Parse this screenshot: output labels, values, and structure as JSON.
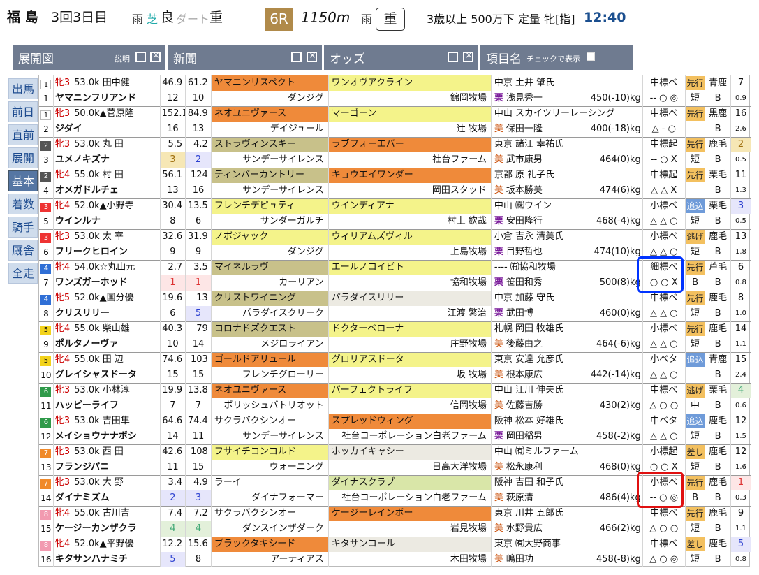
{
  "header": {
    "venue": "福 島",
    "meet": "3回3日目",
    "weather_label": "雨",
    "turf_label": "芝",
    "turf_state": "良",
    "dirt_label": "ダート",
    "dirt_state": "重",
    "race_no": "6R",
    "distance": "1150m",
    "weather2": "雨",
    "track_condition": "重",
    "class": "3歳以上 500万下 定量 牝[指]",
    "post_time": "12:40"
  },
  "toolbar": {
    "tenkai": "展開図",
    "setsumei": "説明",
    "shinbun": "新聞",
    "odds": "オッズ",
    "koumoku": "項目名",
    "check_label": "チェックで表示"
  },
  "sidenav": [
    "出馬",
    "前日",
    "直前",
    "展開",
    "基本",
    "着数",
    "騎手",
    "厩舎",
    "全走"
  ],
  "sidenav_active": "基本",
  "colors": {
    "accent": "#6f7b90",
    "blue_highlight": "#0033ff",
    "red_highlight": "#e01010"
  },
  "runners": [
    {
      "frame": "1",
      "frame_color": "#fff",
      "frame_text": "#111",
      "num": "1",
      "sex": "牝3",
      "weight_jockey": "53.0k 田中健",
      "horse": "ヤマニンフリアンド",
      "o1": "46.9",
      "o2": "61.2",
      "r1": "12",
      "r2": "10",
      "sire": "ヤマニンリスペクト",
      "sire_c": "c-orange",
      "damsire": "ダンジグ",
      "dam": "ワンオヴアクライン",
      "dam_c": "c-yellow",
      "breeder": "錦岡牧場",
      "owner": "中京 土井 肇氏",
      "trainer": "浅見秀一",
      "tr_region": "栗",
      "weight": "450(-10)kg",
      "ind1": "中標べ",
      "ind2": "-- ○ ◎",
      "style": "先行",
      "st2": "短",
      "coat": "青鹿",
      "coat2": "B",
      "pop": "7",
      "pop2": "0.9",
      "pc": ""
    },
    {
      "frame": "1",
      "frame_color": "#fff",
      "frame_text": "#111",
      "num": "2",
      "sex": "牝3",
      "weight_jockey": "50.0k▲菅原隆",
      "horse": "ジダイ",
      "o1": "152.1",
      "o2": "84.9",
      "r1": "16",
      "r2": "13",
      "sire": "ネオユニヴァース",
      "sire_c": "c-orange",
      "damsire": "デイジュール",
      "dam": "マーゴーン",
      "dam_c": "c-yellow",
      "breeder": "辻 牧場",
      "owner": "中山 スカイツリーレーシング",
      "trainer": "保田一隆",
      "tr_region": "美",
      "weight": "400(-18)kg",
      "ind1": "中標べ",
      "ind2": "△ - ○",
      "style": "先行",
      "st2": "",
      "coat": "黒鹿",
      "coat2": "B",
      "pop": "16",
      "pop2": "2.6",
      "pc": ""
    },
    {
      "frame": "2",
      "frame_color": "#555",
      "frame_text": "#fff",
      "num": "3",
      "sex": "牝3",
      "weight_jockey": "53.0k 丸 田",
      "horse": "ユメノキズナ",
      "o1": "5.5",
      "o2": "4.2",
      "r1": "3",
      "r2": "2",
      "sire": "ストラヴィンスキー",
      "sire_c": "c-khaki",
      "damsire": "サンデーサイレンス",
      "dam": "ラブフォーエバー",
      "dam_c": "c-orange",
      "breeder": "社台ファーム",
      "owner": "東京 諸江 幸祐氏",
      "trainer": "武市康男",
      "tr_region": "美",
      "weight": "464(0)kg",
      "ind1": "中標起",
      "ind2": "-- ○ X",
      "style": "先行",
      "st2": "短",
      "coat": "鹿毛",
      "coat2": "B",
      "pop": "2",
      "pop2": "0.5",
      "pc": "p3",
      "rc": "p3",
      "rc2": "p2"
    },
    {
      "frame": "2",
      "frame_color": "#555",
      "frame_text": "#fff",
      "num": "4",
      "sex": "牝4",
      "weight_jockey": "55.0k 村 田",
      "horse": "オメガドルチェ",
      "o1": "56.1",
      "o2": "124",
      "r1": "13",
      "r2": "16",
      "sire": "ティンバーカントリー",
      "sire_c": "c-khaki",
      "damsire": "サンデーサイレンス",
      "dam": "キョウエイワンダー",
      "dam_c": "c-orange",
      "breeder": "岡田スタッド",
      "owner": "京都 原 礼子氏",
      "trainer": "坂本勝美",
      "tr_region": "美",
      "weight": "474(6)kg",
      "ind1": "中標起",
      "ind2": "△ △ X",
      "style": "先行",
      "st2": "",
      "coat": "栗毛",
      "coat2": "B",
      "pop": "11",
      "pop2": "1.3",
      "pc": ""
    },
    {
      "frame": "3",
      "frame_color": "#e33",
      "frame_text": "#fff",
      "num": "5",
      "sex": "牝4",
      "weight_jockey": "52.0k▲小野寺",
      "horse": "ウインルナ",
      "o1": "30.4",
      "o2": "13.5",
      "r1": "8",
      "r2": "6",
      "sire": "フレンチデピュティ",
      "sire_c": "c-yellow",
      "damsire": "サンダーガルチ",
      "dam": "ウインディアナ",
      "dam_c": "c-yellow",
      "breeder": "村上 欽哉",
      "owner": "中山 ㈱ウイン",
      "trainer": "安田隆行",
      "tr_region": "栗",
      "weight": "468(-4)kg",
      "ind1": "小標べ",
      "ind2": "△ △ ○",
      "style": "追込",
      "st2": "短",
      "coat": "栗毛",
      "coat2": "B",
      "pop": "3",
      "pop2": "0.5",
      "pc": "p5",
      "sb": "b"
    },
    {
      "frame": "3",
      "frame_color": "#e33",
      "frame_text": "#fff",
      "num": "6",
      "sex": "牝3",
      "weight_jockey": "53.0k 太 宰",
      "horse": "フリークヒロイン",
      "o1": "32.6",
      "o2": "31.9",
      "r1": "9",
      "r2": "9",
      "sire": "ノボジャック",
      "sire_c": "c-yellow",
      "damsire": "ダンジグ",
      "dam": "ウィリアムズヴィル",
      "dam_c": "c-yellow",
      "breeder": "上島牧場",
      "owner": "小倉 吉永 清美氏",
      "trainer": "目野哲也",
      "tr_region": "栗",
      "weight": "474(10)kg",
      "ind1": "小標べ",
      "ind2": "△ △ ○",
      "style": "逃げ",
      "st2": "短",
      "coat": "鹿毛",
      "coat2": "B",
      "pop": "13",
      "pop2": "1.8",
      "pc": ""
    },
    {
      "frame": "4",
      "frame_color": "#2f6fd6",
      "frame_text": "#fff",
      "num": "7",
      "sex": "牝4",
      "weight_jockey": "54.0k☆丸山元",
      "horse": "ワンズガーホッド",
      "o1": "2.7",
      "o2": "3.5",
      "r1": "1",
      "r2": "1",
      "sire": "マイネルラヴ",
      "sire_c": "c-khaki",
      "damsire": "カーリアン",
      "dam": "エールノコイビト",
      "dam_c": "c-yellow",
      "breeder": "協和牧場",
      "owner": "---- ㈲協和牧場",
      "trainer": "笹田和秀",
      "tr_region": "栗",
      "weight": "500(8)kg",
      "ind1": "細標べ",
      "ind2": "○ ○ X",
      "style": "先行",
      "st2": "B",
      "coat": "芦毛",
      "coat2": "B",
      "pop": "6",
      "pop2": "0.8",
      "pc": "",
      "rc": "p1",
      "rc2": "p1"
    },
    {
      "frame": "4",
      "frame_color": "#2f6fd6",
      "frame_text": "#fff",
      "num": "8",
      "sex": "牝5",
      "weight_jockey": "52.0k▲国分優",
      "horse": "クリスリリー",
      "o1": "19.6",
      "o2": "13",
      "r1": "6",
      "r2": "5",
      "sire": "クリストワイニング",
      "sire_c": "c-khaki",
      "damsire": "パラダイスクリーク",
      "dam": "パラダイスリリー",
      "dam_c": "c-gray",
      "breeder": "江渡 繁治",
      "owner": "中京 加藤 守氏",
      "trainer": "武田博",
      "tr_region": "栗",
      "weight": "460(0)kg",
      "ind1": "中標べ",
      "ind2": "△ △ ○",
      "style": "先行",
      "st2": "短",
      "coat": "鹿毛",
      "coat2": "B",
      "pop": "8",
      "pop2": "1.0",
      "pc": "",
      "rc2": "p2"
    },
    {
      "frame": "5",
      "frame_color": "#f2d21b",
      "frame_text": "#111",
      "num": "9",
      "sex": "牝4",
      "weight_jockey": "55.0k 柴山雄",
      "horse": "ポルタノーヴァ",
      "o1": "40.3",
      "o2": "79",
      "r1": "10",
      "r2": "14",
      "sire": "コロナドズクエスト",
      "sire_c": "c-khaki",
      "damsire": "メジロライアン",
      "dam": "ドクターベローナ",
      "dam_c": "c-yellow",
      "breeder": "庄野牧場",
      "owner": "札幌 岡田 牧雄氏",
      "trainer": "後藤由之",
      "tr_region": "美",
      "weight": "464(-6)kg",
      "ind1": "小標べ",
      "ind2": "△ △ ○",
      "style": "先行",
      "st2": "短",
      "coat": "鹿毛",
      "coat2": "B",
      "pop": "14",
      "pop2": "1.1",
      "pc": ""
    },
    {
      "frame": "5",
      "frame_color": "#f2d21b",
      "frame_text": "#111",
      "num": "10",
      "sex": "牝4",
      "weight_jockey": "55.0k 田 辺",
      "horse": "グレイシャスドータ",
      "o1": "74.6",
      "o2": "103",
      "r1": "15",
      "r2": "15",
      "sire": "ゴールドアリュール",
      "sire_c": "c-orange",
      "damsire": "フレンチグローリー",
      "dam": "グロリアスドータ",
      "dam_c": "c-yellow",
      "breeder": "坂 牧場",
      "owner": "東京 安達 允彦氏",
      "trainer": "根本康広",
      "tr_region": "美",
      "weight": "442(-14)kg",
      "ind1": "小ベタ",
      "ind2": "△ △ ○",
      "style": "追込",
      "st2": "",
      "coat": "青鹿",
      "coat2": "B",
      "pop": "15",
      "pop2": "2.4",
      "pc": "",
      "sb": "b"
    },
    {
      "frame": "6",
      "frame_color": "#2f9a4a",
      "frame_text": "#fff",
      "num": "11",
      "sex": "牝3",
      "weight_jockey": "53.0k 小林淳",
      "horse": "ハッピーライフ",
      "o1": "19.9",
      "o2": "13.8",
      "r1": "7",
      "r2": "7",
      "sire": "ネオユニヴァース",
      "sire_c": "c-orange",
      "damsire": "ポリッシュパトリオット",
      "dam": "パーフェクトライフ",
      "dam_c": "c-yellow",
      "breeder": "信岡牧場",
      "owner": "中山 江川 伸夫氏",
      "trainer": "佐藤吉勝",
      "tr_region": "美",
      "weight": "430(2)kg",
      "ind1": "中標べ",
      "ind2": "△ ○ ○",
      "style": "逃げ",
      "st2": "中",
      "coat": "栗毛",
      "coat2": "B",
      "pop": "4",
      "pop2": "0.6",
      "pc": "p4"
    },
    {
      "frame": "6",
      "frame_color": "#2f9a4a",
      "frame_text": "#fff",
      "num": "12",
      "sex": "牝3",
      "weight_jockey": "53.0k 吉田隼",
      "horse": "メイショウナナボシ",
      "o1": "64.6",
      "o2": "74.4",
      "r1": "14",
      "r2": "11",
      "sire": "サクラバクシンオー",
      "sire_c": "",
      "damsire": "サンデーサイレンス",
      "dam": "スプレッドウィング",
      "dam_c": "c-orange",
      "breeder": "社台コーポレーション白老ファーム",
      "owner": "阪神 松本 好雄氏",
      "trainer": "岡田稲男",
      "tr_region": "栗",
      "weight": "458(-2)kg",
      "ind1": "中ベタ",
      "ind2": "△ △ ○",
      "style": "追込",
      "st2": "短",
      "coat": "鹿毛",
      "coat2": "B",
      "pop": "12",
      "pop2": "1.5",
      "pc": "",
      "sb": "b"
    },
    {
      "frame": "7",
      "frame_color": "#f08a2a",
      "frame_text": "#fff",
      "num": "13",
      "sex": "牝3",
      "weight_jockey": "53.0k 西 田",
      "horse": "フランジパニ",
      "o1": "42.6",
      "o2": "108",
      "r1": "11",
      "r2": "15",
      "sire": "フサイチコンコルド",
      "sire_c": "c-yellow",
      "damsire": "ウォーニング",
      "dam": "ホッカイキャシー",
      "dam_c": "c-gray",
      "breeder": "日高大洋牧場",
      "owner": "中山 ㈲ミルファーム",
      "trainer": "松永康利",
      "tr_region": "美",
      "weight": "468(0)kg",
      "ind1": "小標起",
      "ind2": "○ ○ X",
      "style": "差し",
      "st2": "短",
      "coat": "鹿毛",
      "coat2": "B",
      "pop": "12",
      "pop2": "1.6",
      "pc": ""
    },
    {
      "frame": "7",
      "frame_color": "#f08a2a",
      "frame_text": "#fff",
      "num": "14",
      "sex": "牝3",
      "weight_jockey": "53.0k 大 野",
      "horse": "ダイナミズム",
      "o1": "3.4",
      "o2": "4.9",
      "r1": "2",
      "r2": "3",
      "sire": "ラーイ",
      "sire_c": "",
      "damsire": "ダイナフォーマー",
      "dam": "ダイナスクラブ",
      "dam_c": "c-green",
      "breeder": "社台コーポレーション白老ファーム",
      "owner": "阪神 吉田 和子氏",
      "trainer": "萩原清",
      "tr_region": "美",
      "weight": "486(4)kg",
      "ind1": "小標べ",
      "ind2": "-- ○ ◎",
      "style": "先行",
      "st2": "B",
      "coat": "鹿毛",
      "coat2": "B",
      "pop": "1",
      "pop2": "0.3",
      "pc": "p1",
      "rc": "p2",
      "rc2": "p2"
    },
    {
      "frame": "8",
      "frame_color": "#f29ab0",
      "frame_text": "#fff",
      "num": "15",
      "sex": "牝4",
      "weight_jockey": "55.0k 古川吉",
      "horse": "ケージーカンザクラ",
      "o1": "7.4",
      "o2": "7.2",
      "r1": "4",
      "r2": "4",
      "sire": "サクラバクシンオー",
      "sire_c": "",
      "damsire": "ダンスインザダーク",
      "dam": "ケージーレインボー",
      "dam_c": "c-orange",
      "breeder": "岩見牧場",
      "owner": "東京 川井 五郎氏",
      "trainer": "水野貴広",
      "tr_region": "美",
      "weight": "466(2)kg",
      "ind1": "中標べ",
      "ind2": "△ ○ ○",
      "style": "先行",
      "st2": "短",
      "coat": "鹿毛",
      "coat2": "B",
      "pop": "9",
      "pop2": "1.1",
      "pc": "",
      "rc": "p4",
      "rc2": "p4"
    },
    {
      "frame": "8",
      "frame_color": "#f29ab0",
      "frame_text": "#fff",
      "num": "16",
      "sex": "牝4",
      "weight_jockey": "52.0k▲平野優",
      "horse": "キタサンハナミチ",
      "o1": "12.2",
      "o2": "15.6",
      "r1": "5",
      "r2": "8",
      "sire": "ブラックタキシード",
      "sire_c": "c-orange",
      "damsire": "アーティアス",
      "dam": "キタサンコール",
      "dam_c": "c-gray",
      "breeder": "木田牧場",
      "owner": "東京 ㈲大野商事",
      "trainer": "嶋田功",
      "tr_region": "美",
      "weight": "458(-8)kg",
      "ind1": "中標べ",
      "ind2": "△ ○ ◎",
      "style": "差し",
      "st2": "短",
      "coat": "鹿毛",
      "coat2": "B",
      "pop": "5",
      "pop2": "0.8",
      "pc": "p5",
      "rc": "p5"
    }
  ]
}
